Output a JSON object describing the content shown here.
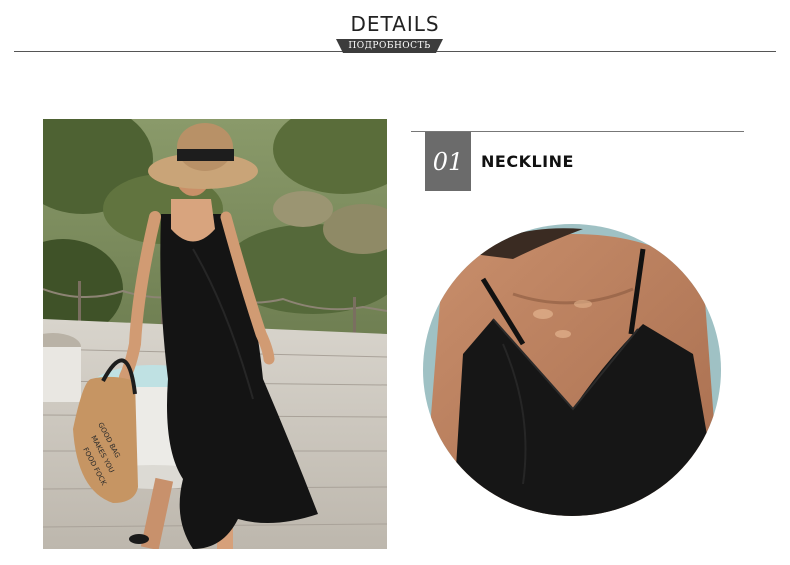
{
  "header": {
    "title": "DETAILS",
    "subtitle": "ПОДРОБНОСТЬ"
  },
  "photo": {
    "bag_text": "GOOD BAG MAKES YOU FOOD FOCK"
  },
  "detail": {
    "number": "01",
    "label": "NECKLINE"
  },
  "colors": {
    "accent": "#6b6b6b",
    "badge": "#3c3c3c",
    "dress": "#141414"
  }
}
